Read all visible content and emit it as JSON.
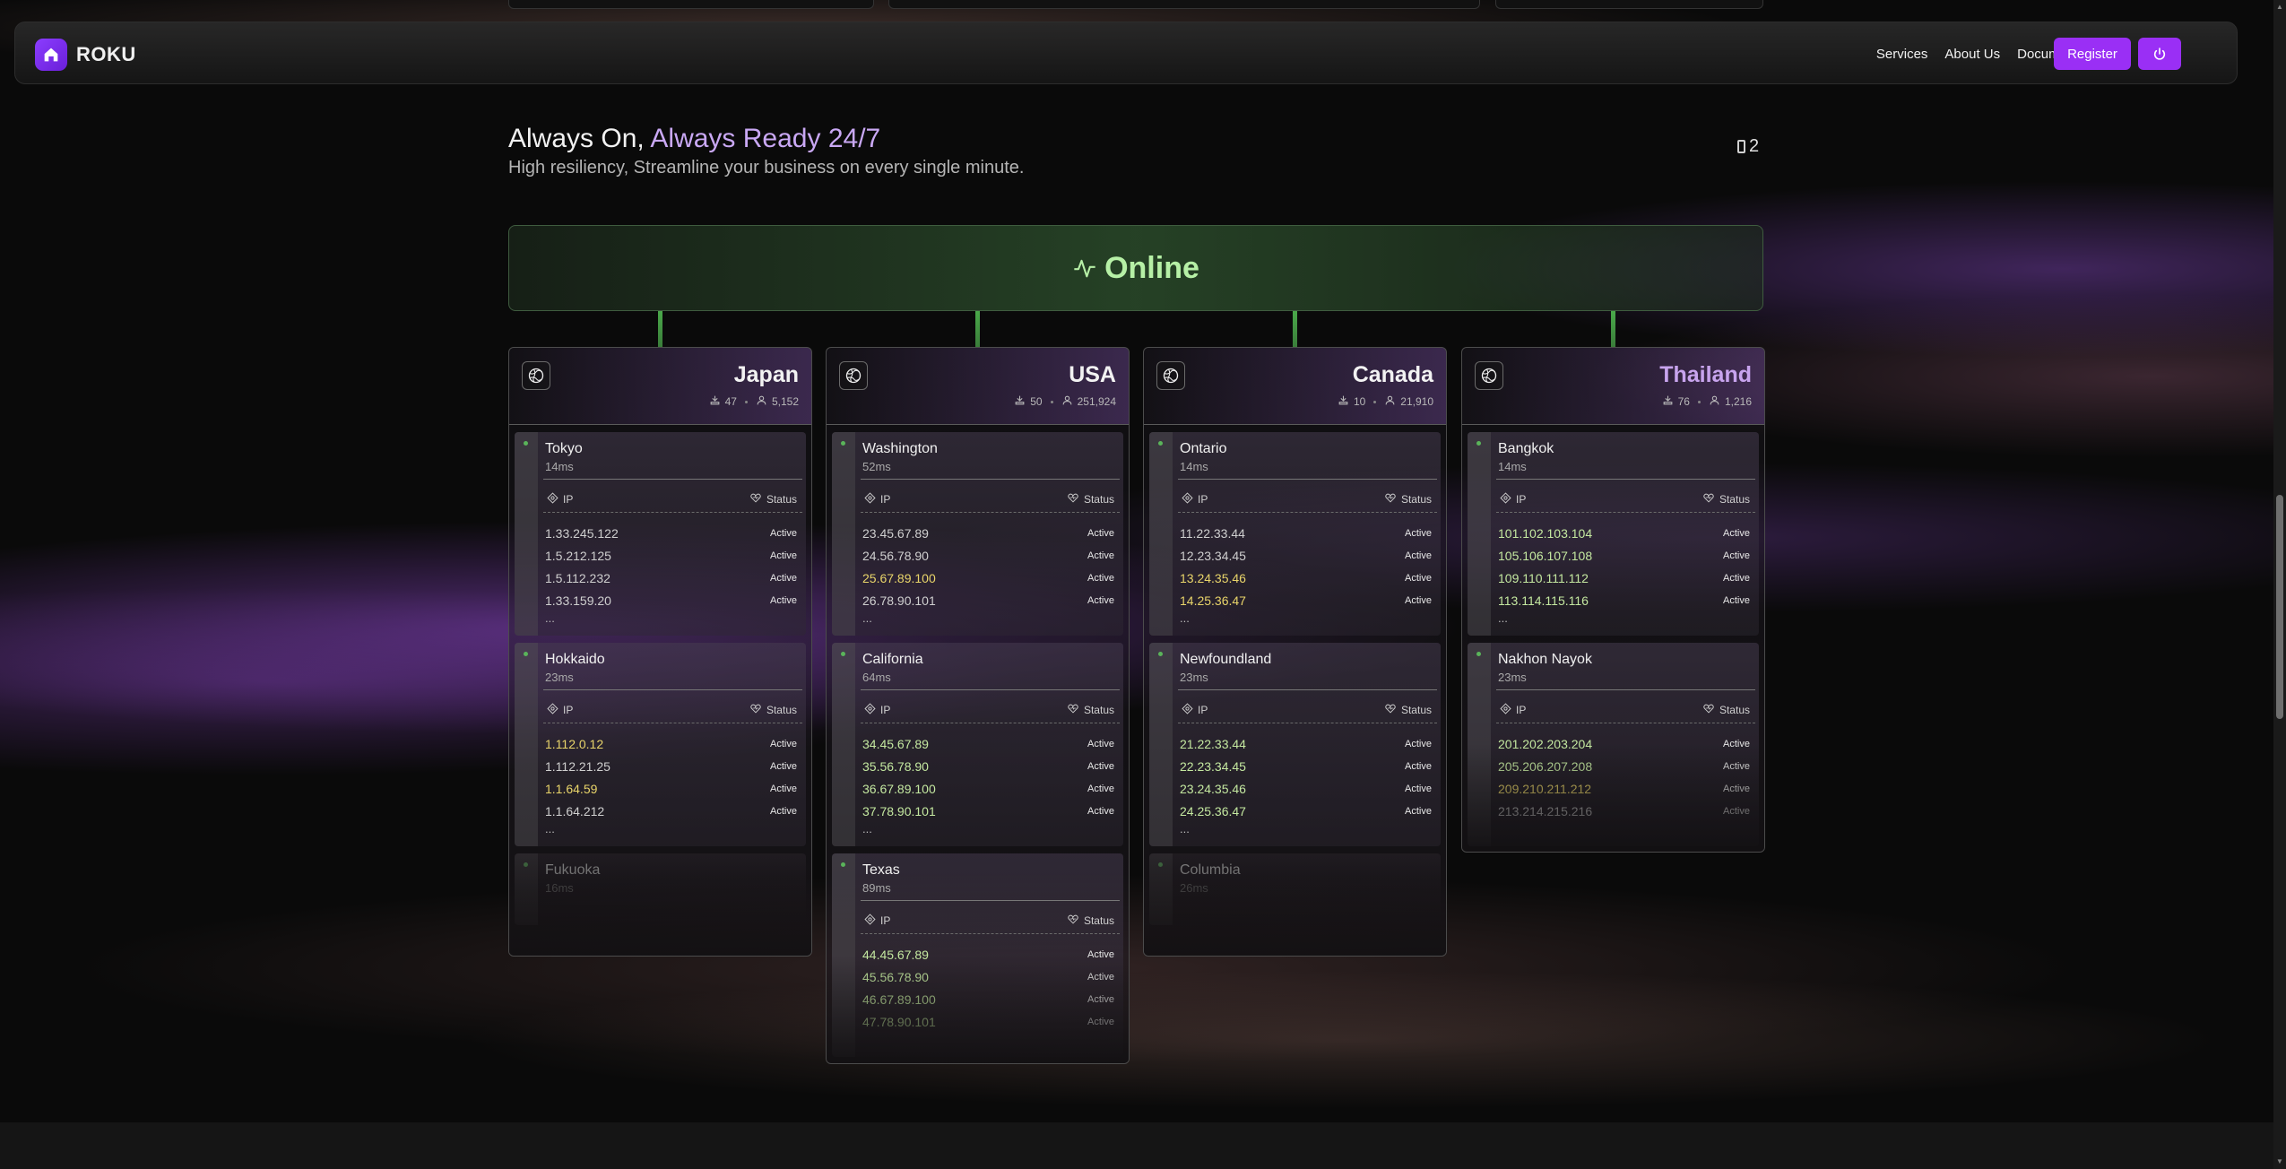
{
  "nav": {
    "brand": "ROKU",
    "links": [
      "Services",
      "About Us",
      "Documents"
    ],
    "register_label": "Register"
  },
  "heading": {
    "title_prefix": "Always On, ",
    "title_accent": "Always Ready 24/7",
    "subtitle": "High resiliency, Streamline your business on every single minute.",
    "page_count": "2"
  },
  "status": {
    "label": "Online",
    "color": "#b6f0a6"
  },
  "table_headers": {
    "ip": "IP",
    "status": "Status"
  },
  "countries": [
    {
      "name": "Japan",
      "servers": "47",
      "users": "5,152",
      "cities": [
        {
          "name": "Tokyo",
          "ping": "14ms",
          "ips": [
            {
              "ip": "1.33.245.122",
              "status": "Active",
              "tone": ""
            },
            {
              "ip": "1.5.212.125",
              "status": "Active",
              "tone": ""
            },
            {
              "ip": "1.5.112.232",
              "status": "Active",
              "tone": ""
            },
            {
              "ip": "1.33.159.20",
              "status": "Active",
              "tone": ""
            }
          ],
          "more": "..."
        },
        {
          "name": "Hokkaido",
          "ping": "23ms",
          "ips": [
            {
              "ip": "1.112.0.12",
              "status": "Active",
              "tone": "y"
            },
            {
              "ip": "1.112.21.25",
              "status": "Active",
              "tone": ""
            },
            {
              "ip": "1.1.64.59",
              "status": "Active",
              "tone": "y"
            },
            {
              "ip": "1.1.64.212",
              "status": "Active",
              "tone": ""
            }
          ],
          "more": "..."
        }
      ],
      "faded": {
        "name": "Fukuoka",
        "ping": "16ms"
      }
    },
    {
      "name": "USA",
      "servers": "50",
      "users": "251,924",
      "cities": [
        {
          "name": "Washington",
          "ping": "52ms",
          "ips": [
            {
              "ip": "23.45.67.89",
              "status": "Active",
              "tone": ""
            },
            {
              "ip": "24.56.78.90",
              "status": "Active",
              "tone": ""
            },
            {
              "ip": "25.67.89.100",
              "status": "Active",
              "tone": "y"
            },
            {
              "ip": "26.78.90.101",
              "status": "Active",
              "tone": ""
            }
          ],
          "more": "..."
        },
        {
          "name": "California",
          "ping": "64ms",
          "ips": [
            {
              "ip": "34.45.67.89",
              "status": "Active",
              "tone": "g"
            },
            {
              "ip": "35.56.78.90",
              "status": "Active",
              "tone": "g"
            },
            {
              "ip": "36.67.89.100",
              "status": "Active",
              "tone": "g"
            },
            {
              "ip": "37.78.90.101",
              "status": "Active",
              "tone": "g"
            }
          ],
          "more": "..."
        },
        {
          "name": "Texas",
          "ping": "89ms",
          "ips": [
            {
              "ip": "44.45.67.89",
              "status": "Active",
              "tone": "g"
            },
            {
              "ip": "45.56.78.90",
              "status": "Active",
              "tone": "g"
            },
            {
              "ip": "46.67.89.100",
              "status": "Active",
              "tone": "g"
            },
            {
              "ip": "47.78.90.101",
              "status": "Active",
              "tone": "g"
            }
          ],
          "more": ""
        }
      ],
      "faded": null
    },
    {
      "name": "Canada",
      "servers": "10",
      "users": "21,910",
      "cities": [
        {
          "name": "Ontario",
          "ping": "14ms",
          "ips": [
            {
              "ip": "11.22.33.44",
              "status": "Active",
              "tone": ""
            },
            {
              "ip": "12.23.34.45",
              "status": "Active",
              "tone": ""
            },
            {
              "ip": "13.24.35.46",
              "status": "Active",
              "tone": "y"
            },
            {
              "ip": "14.25.36.47",
              "status": "Active",
              "tone": "y"
            }
          ],
          "more": "..."
        },
        {
          "name": "Newfoundland",
          "ping": "23ms",
          "ips": [
            {
              "ip": "21.22.33.44",
              "status": "Active",
              "tone": "g"
            },
            {
              "ip": "22.23.34.45",
              "status": "Active",
              "tone": "g"
            },
            {
              "ip": "23.24.35.46",
              "status": "Active",
              "tone": "g"
            },
            {
              "ip": "24.25.36.47",
              "status": "Active",
              "tone": "g"
            }
          ],
          "more": "..."
        }
      ],
      "faded": {
        "name": "Columbia",
        "ping": "26ms"
      }
    },
    {
      "name": "Thailand",
      "servers": "76",
      "users": "1,216",
      "cities": [
        {
          "name": "Bangkok",
          "ping": "14ms",
          "ips": [
            {
              "ip": "101.102.103.104",
              "status": "Active",
              "tone": "g"
            },
            {
              "ip": "105.106.107.108",
              "status": "Active",
              "tone": "g"
            },
            {
              "ip": "109.110.111.112",
              "status": "Active",
              "tone": "g"
            },
            {
              "ip": "113.114.115.116",
              "status": "Active",
              "tone": "g"
            }
          ],
          "more": "..."
        },
        {
          "name": "Nakhon Nayok",
          "ping": "23ms",
          "ips": [
            {
              "ip": "201.202.203.204",
              "status": "Active",
              "tone": "g"
            },
            {
              "ip": "205.206.207.208",
              "status": "Active",
              "tone": "g"
            },
            {
              "ip": "209.210.211.212",
              "status": "Active",
              "tone": "y"
            },
            {
              "ip": "213.214.215.216",
              "status": "Active",
              "tone": ""
            }
          ],
          "more": ""
        }
      ],
      "faded": null
    }
  ],
  "colors": {
    "accent": "#9a2ff5",
    "online_green": "#4aa94a",
    "warn_yellow": "#e9d56a"
  }
}
